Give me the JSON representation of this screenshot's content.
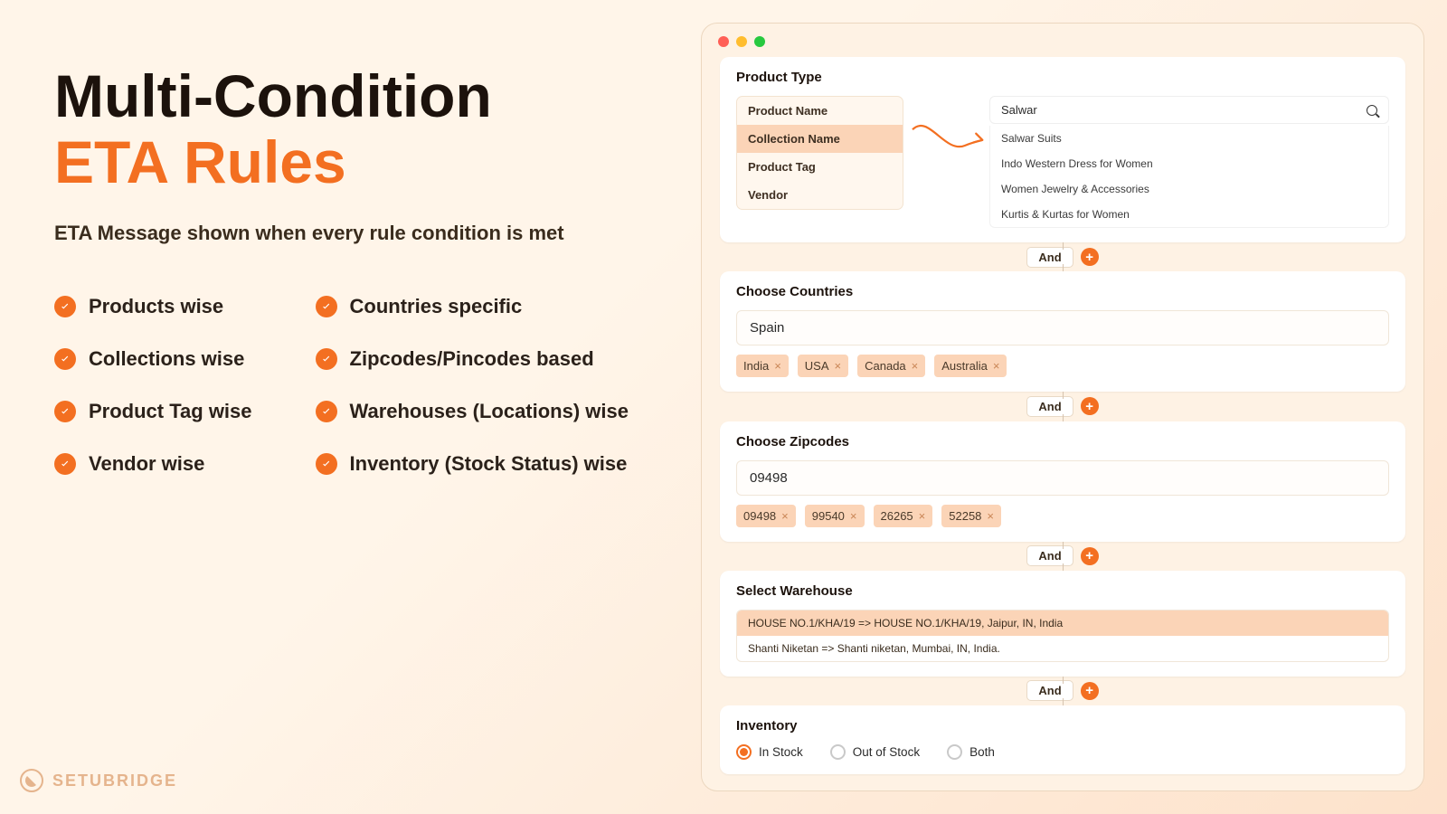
{
  "left": {
    "title_line1": "Multi-Condition",
    "title_line2": "ETA Rules",
    "tagline": "ETA Message shown when every rule condition is met",
    "features_col1": [
      "Products wise",
      "Collections wise",
      "Product Tag wise",
      "Vendor wise"
    ],
    "features_col2": [
      "Countries specific",
      "Zipcodes/Pincodes based",
      "Warehouses (Locations) wise",
      "Inventory (Stock Status) wise"
    ]
  },
  "brand": "SETUBRIDGE",
  "connector": {
    "and_label": "And"
  },
  "product_type": {
    "title": "Product Type",
    "tabs": [
      "Product Name",
      "Collection Name",
      "Product Tag",
      "Vendor"
    ],
    "active_tab_index": 1,
    "search_value": "Salwar",
    "suggestions": [
      "Salwar Suits",
      "Indo Western Dress for Women",
      "Women Jewelry & Accessories",
      "Kurtis & Kurtas for Women"
    ]
  },
  "countries": {
    "title": "Choose Countries",
    "input_value": "Spain",
    "chips": [
      "India",
      "USA",
      "Canada",
      "Australia"
    ]
  },
  "zipcodes": {
    "title": "Choose Zipcodes",
    "input_value": "09498",
    "chips": [
      "09498",
      "99540",
      "26265",
      "52258"
    ]
  },
  "warehouse": {
    "title": "Select Warehouse",
    "items": [
      "HOUSE NO.1/KHA/19 => HOUSE NO.1/KHA/19, Jaipur, IN, India",
      "Shanti Niketan => Shanti niketan, Mumbai, IN, India."
    ],
    "active_index": 0
  },
  "inventory": {
    "title": "Inventory",
    "options": [
      "In Stock",
      "Out of Stock",
      "Both"
    ],
    "selected_index": 0
  }
}
